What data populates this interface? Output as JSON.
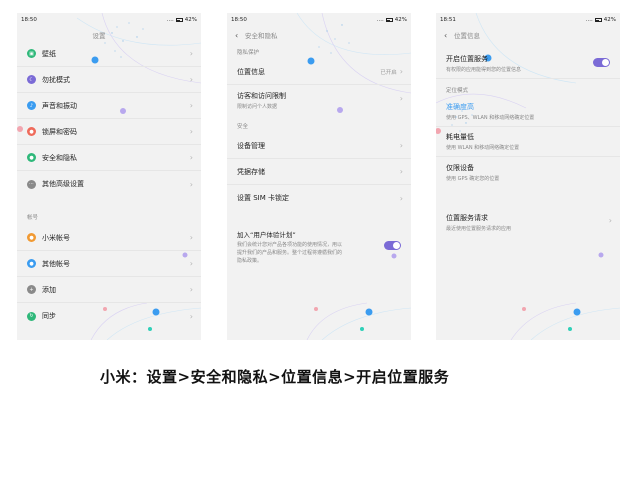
{
  "colors": {
    "accent": "#7b6bd6",
    "screen_bg": "#f2f2f2",
    "icon_wallpaper": "#2fb87a",
    "icon_dnd": "#7b6bd6",
    "icon_sound": "#3b9cf0",
    "icon_lock": "#ef6b5b",
    "icon_security": "#2fb87a",
    "icon_advanced": "#8a8a8a",
    "icon_mi_account": "#f19a33",
    "icon_other_account": "#3b9cf0",
    "icon_add": "#8a8a8a",
    "icon_sync": "#2fb87a"
  },
  "screen1": {
    "status": {
      "time": "18:50",
      "signal": "....",
      "battery": "42%"
    },
    "title": "设置",
    "items": [
      {
        "label": "壁纸",
        "icon": "wallpaper-icon"
      },
      {
        "label": "勿扰模式",
        "icon": "moon-icon"
      },
      {
        "label": "声音和振动",
        "icon": "sound-icon"
      },
      {
        "label": "锁屏和密码",
        "icon": "lock-icon"
      },
      {
        "label": "安全和隐私",
        "icon": "shield-icon"
      },
      {
        "label": "其他高级设置",
        "icon": "more-icon"
      }
    ],
    "section_account": "帐号",
    "account_items": [
      {
        "label": "小米帐号",
        "icon": "mi-account-icon"
      },
      {
        "label": "其他帐号",
        "icon": "user-icon"
      },
      {
        "label": "添加",
        "icon": "add-icon"
      },
      {
        "label": "同步",
        "icon": "sync-icon"
      }
    ]
  },
  "screen2": {
    "status": {
      "time": "18:50",
      "signal": "....",
      "battery": "42%"
    },
    "title": "安全和隐私",
    "section_privacy": "隐私保护",
    "location": {
      "label": "位置信息",
      "value": "已开启"
    },
    "access": {
      "label": "访客和访问限制",
      "sub": "限制访问个人数据"
    },
    "section_security": "安全",
    "security_items": [
      {
        "label": "设备管理"
      },
      {
        "label": "凭据存储"
      },
      {
        "label": "设置 SIM 卡锁定"
      }
    ],
    "ux": {
      "label": "加入“用户体验计划”",
      "desc1": "我们会统计您对产品各项功能的使用情况，用以",
      "desc2": "提升我们的产品和服务。整个过程将遵循我们的",
      "desc3": "隐私政策。"
    }
  },
  "screen3": {
    "status": {
      "time": "18:51",
      "signal": "....",
      "battery": "42%"
    },
    "title": "位置信息",
    "enable": {
      "label": "开启位置服务",
      "sub": "有权限的应用能得到您的位置信息"
    },
    "section_mode": "定位模式",
    "modes": [
      {
        "label": "准确度高",
        "sub": "使用 GPS、WLAN 和移动网络确定位置"
      },
      {
        "label": "耗电量低",
        "sub": "使用 WLAN 和移动网络确定位置"
      },
      {
        "label": "仅限设备",
        "sub": "使用 GPS 确定您的位置"
      }
    ],
    "requests": {
      "label": "位置服务请求",
      "sub": "最近使用位置服务请求的应用"
    }
  },
  "caption": "小米：设置>安全和隐私>位置信息>开启位置服务"
}
